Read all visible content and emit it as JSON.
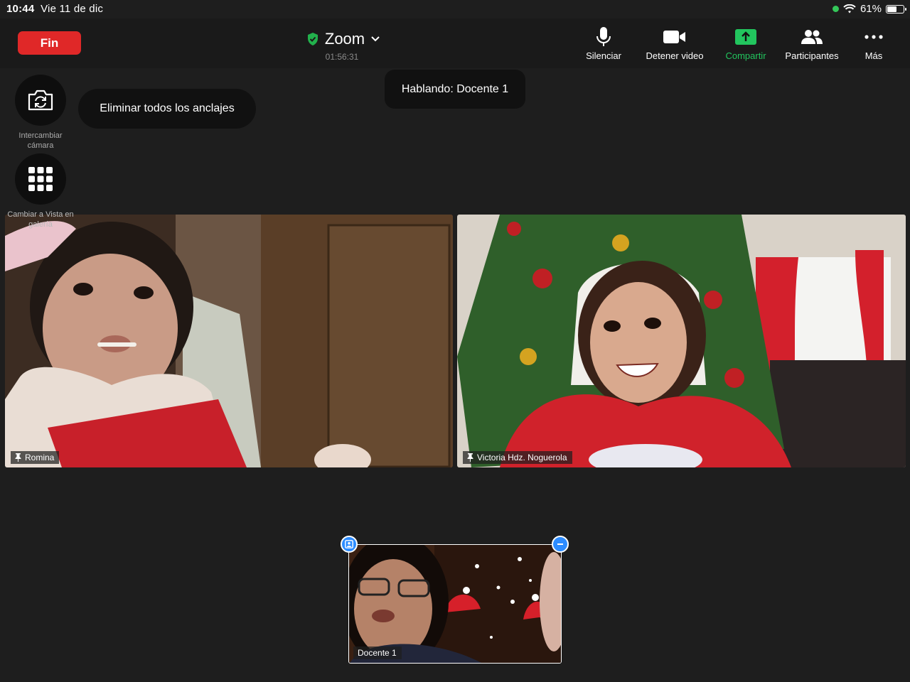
{
  "status_bar": {
    "time": "10:44",
    "date": "Vie 11 de dic",
    "battery": "61%",
    "battery_level": 0.61
  },
  "header": {
    "end_label": "Fin",
    "title": "Zoom",
    "timer": "01:56:31"
  },
  "toolbar": {
    "mute": "Silenciar",
    "stop_video": "Detener video",
    "share": "Compartir",
    "participants": "Participantes",
    "more": "Más"
  },
  "side": {
    "switch_camera": "Intercambiar cámara",
    "gallery_view": "Cambiar a Vista en galería",
    "remove_pins": "Eliminar todos los anclajes"
  },
  "speaking": "Hablando: Docente 1",
  "participants": [
    {
      "name": "Romina"
    },
    {
      "name": "Victoria Hdz. Noguerola"
    }
  ],
  "self_view": {
    "name": "Docente 1"
  },
  "colors": {
    "end_red": "#e02828",
    "share_green": "#22c55e",
    "shield_green": "#22b14c",
    "accent_blue": "#2d8cff"
  }
}
